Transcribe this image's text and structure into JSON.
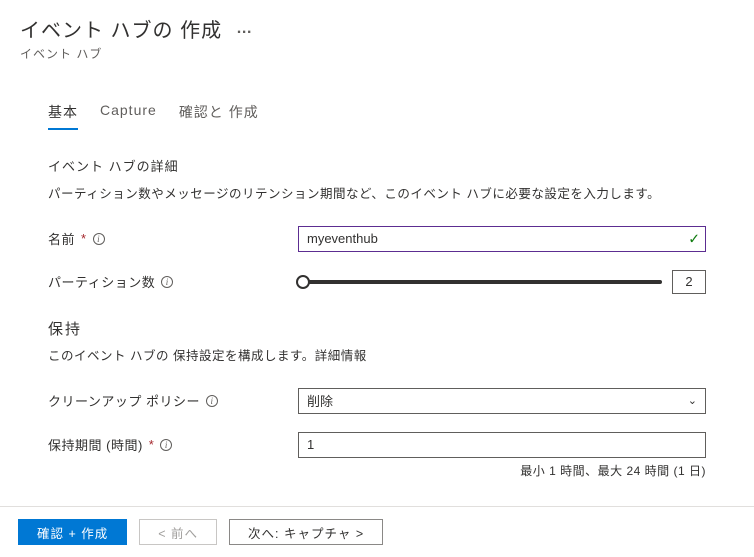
{
  "header": {
    "title": "イベント ハブの 作成",
    "ellipsis": "…",
    "subtitle": "イベント ハブ"
  },
  "tabs": {
    "basic": "基本",
    "capture": "Capture",
    "review": "確認と 作成"
  },
  "sections": {
    "details": {
      "heading": "イベント ハブの詳細",
      "desc": "パーティション数やメッセージのリテンション期間など、このイベント ハブに必要な設定を入力します。"
    },
    "retention": {
      "heading": "保持",
      "desc": "このイベント ハブの 保持設定を構成します。詳細情報"
    }
  },
  "fields": {
    "name": {
      "label": "名前",
      "value": "myeventhub"
    },
    "partition": {
      "label": "パーティション数",
      "value": "2"
    },
    "cleanup": {
      "label": "クリーンアップ ポリシー",
      "value": "削除"
    },
    "retention": {
      "label": "保持期間 (時間)",
      "value": "1",
      "hint": "最小 1 時間、最大 24 時間 (1 日)"
    }
  },
  "footer": {
    "review": "確認 + 作成",
    "prev": "< 前へ",
    "next": "次へ: キャプチャ   >"
  }
}
